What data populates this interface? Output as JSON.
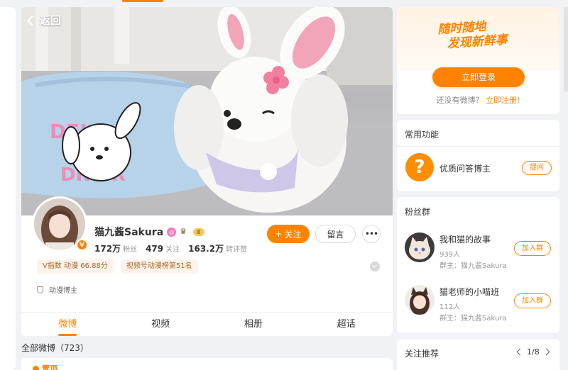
{
  "nav": {
    "back_label": "返回"
  },
  "profile": {
    "name": "猫九酱Sakura",
    "level_badge": "Ⅲ",
    "verified_mark": "V",
    "stats": [
      {
        "value": "172万",
        "label": "粉丝"
      },
      {
        "value": "479",
        "label": "关注"
      },
      {
        "value": "163.2万",
        "label": "转评赞"
      }
    ],
    "follow_label": "关注",
    "message_label": "留言",
    "tags": [
      "V指数 动漫 66.88分",
      "视频号动漫榜第51名"
    ],
    "description": "动漫博主"
  },
  "tabs": [
    "微博",
    "视频",
    "相册",
    "超话"
  ],
  "feed": {
    "header": "全部微博（723）",
    "pinned_label": "置顶"
  },
  "login": {
    "slogan_line1": "随时随地",
    "slogan_line2": "发现新鲜事",
    "button": "立即登录",
    "register_prompt": "还没有微博？",
    "register_link": "立即注册!"
  },
  "functions": {
    "title": "常用功能",
    "item_label": "优质问答博主",
    "item_button": "提问"
  },
  "fan_groups": {
    "title": "粉丝群",
    "groups": [
      {
        "name": "我和猫的故事",
        "count": "939人",
        "owner": "群主：猫九酱Sakura",
        "button": "加入群"
      },
      {
        "name": "猫老师的小喵班",
        "count": "112人",
        "owner": "群主：猫九酱Sakura",
        "button": "加入群"
      }
    ]
  },
  "recommend": {
    "title": "关注推荐",
    "page": "1/8"
  },
  "colors": {
    "accent": "#ff8200",
    "background": "#f1f2f5"
  }
}
